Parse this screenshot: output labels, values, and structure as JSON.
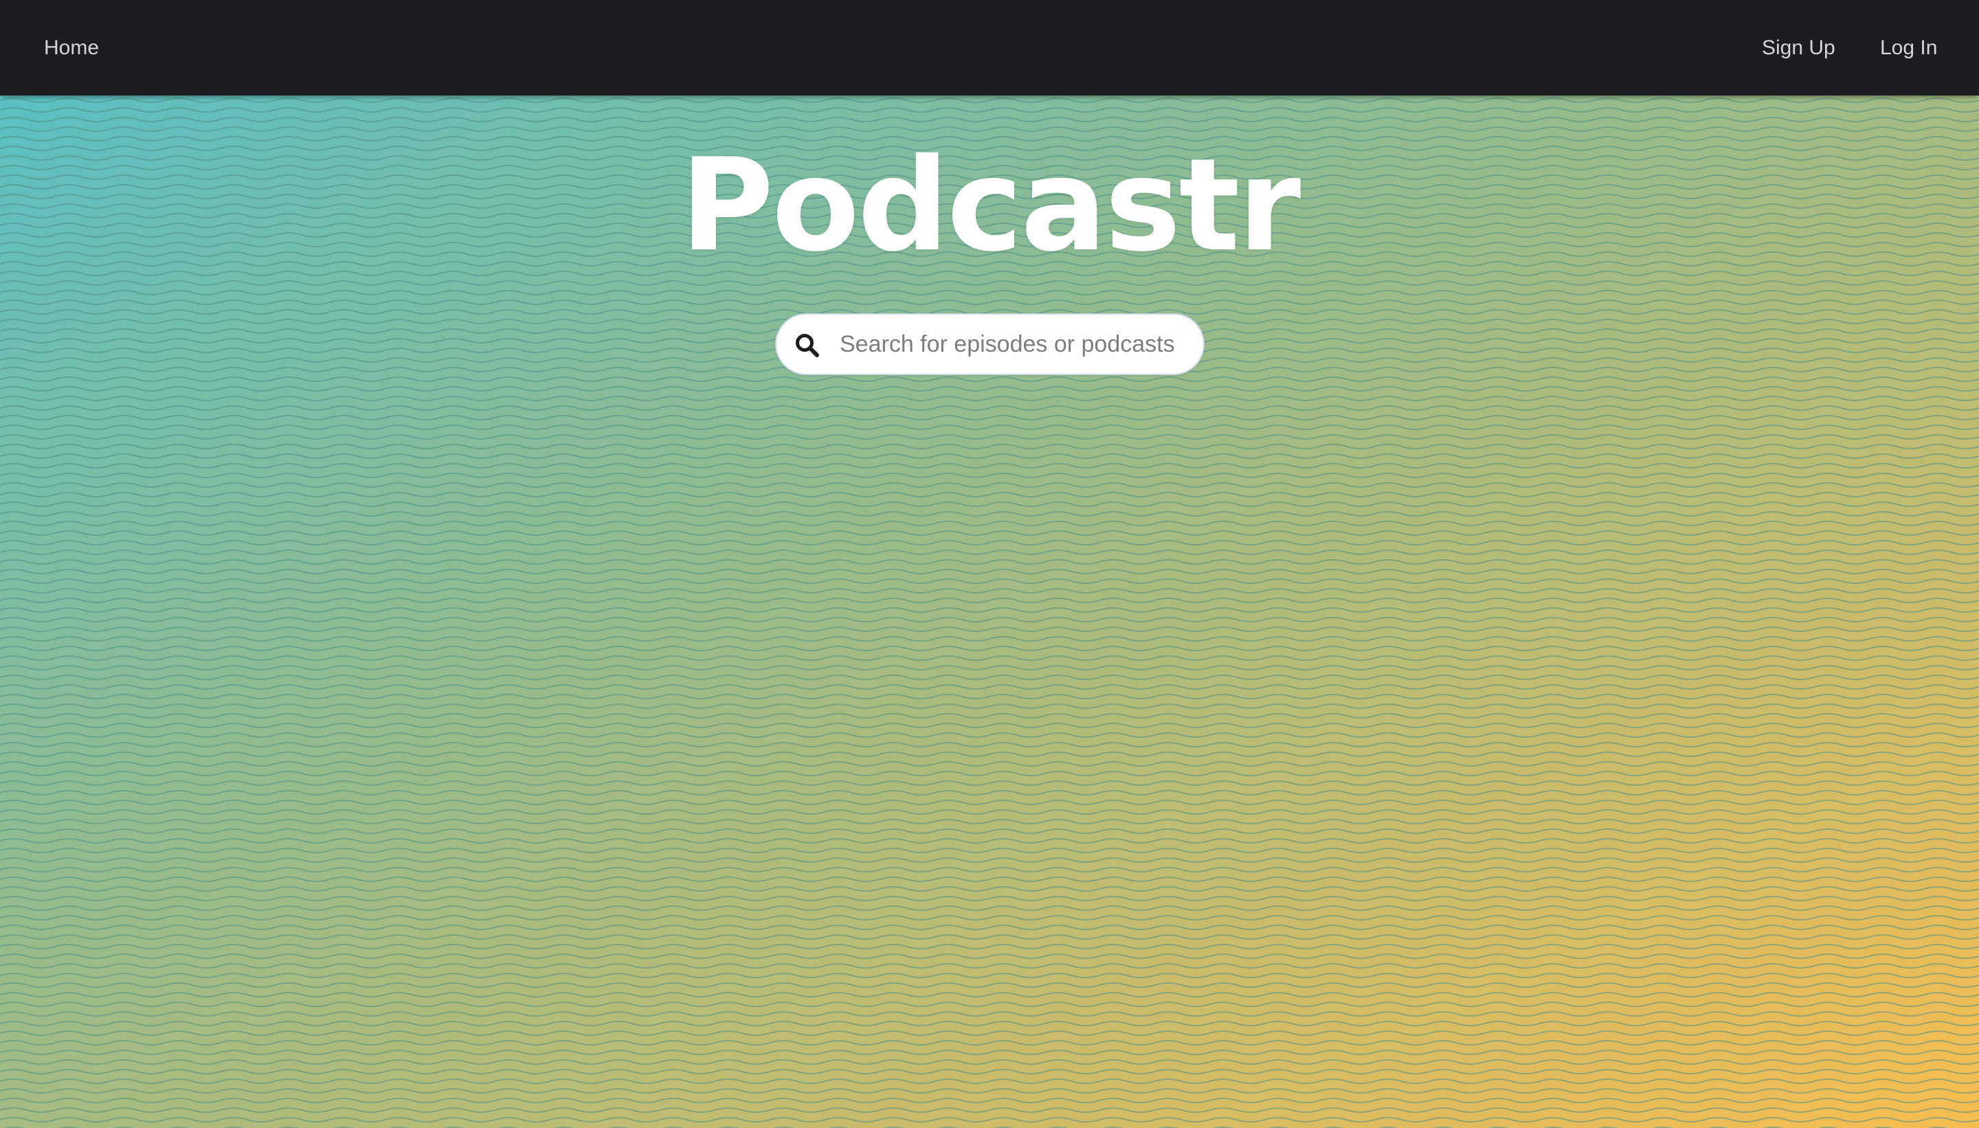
{
  "nav": {
    "home_label": "Home",
    "signup_label": "Sign Up",
    "login_label": "Log In"
  },
  "hero": {
    "title": "Podcastr",
    "gradient_start": "#5bbfc2",
    "gradient_end": "#f7bd4f",
    "wave_color": "#4f8f86"
  },
  "search": {
    "placeholder": "Search for episodes or podcasts",
    "icon": "search-icon"
  },
  "colors": {
    "navbar_bg": "#1c1d20",
    "nav_text": "#d6d6d6"
  }
}
